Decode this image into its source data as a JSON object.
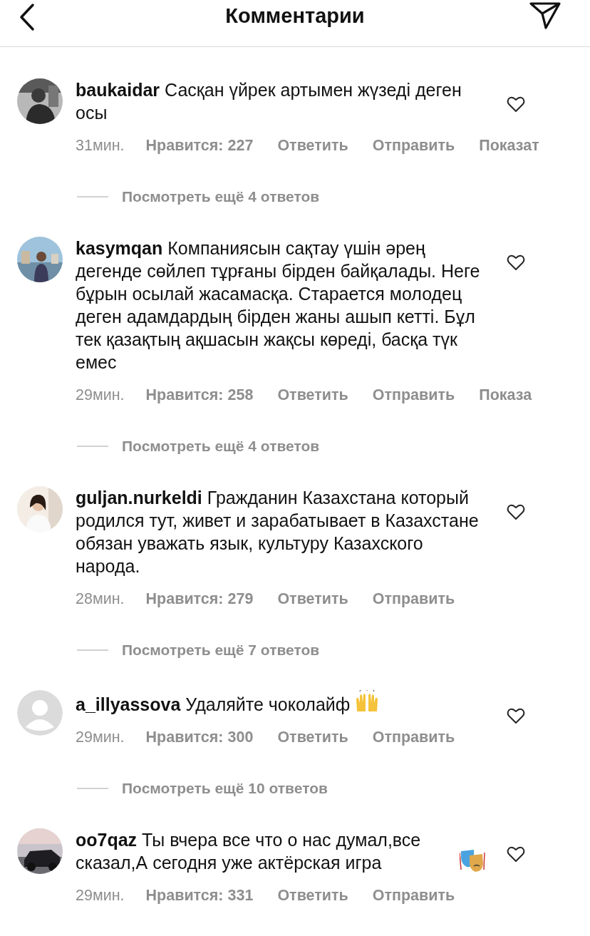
{
  "header": {
    "title": "Комментарии"
  },
  "comments": [
    {
      "text": "**baukaidar** Сасқан үйрек артымен жүзеді деген осы",
      "time": "31мин.",
      "likes": "Нравится: 227",
      "reply": "Ответить",
      "send": "Отправить",
      "more": "Показат",
      "liked": false,
      "replies": "Посмотреть ещё 4 ответов"
    },
    {
      "text": "**kasymqan** Компаниясын сақтау үшін әрең дегенде сөйлеп тұрғаны бірден байқалады. Неге бұрын осылай жасамасқа. Старается молодец деген адамдардың бірден жаны ашып кетті. Бұл тек қазақтың ақшасын жақсы көреді, басқа түк емес",
      "time": "29мин.",
      "likes": "Нравится: 258",
      "reply": "Ответить",
      "send": "Отправить",
      "more": "Показа",
      "liked": false,
      "replies": "Посмотреть ещё 4 ответов"
    },
    {
      "text": "**guljan.nurkeldi** Гражданин Казахстана который родился тут, живет и зарабатывает в Казахстане обязан уважать язык, культуру Казахского народа.",
      "time": "28мин.",
      "likes": "Нравится: 279",
      "reply": "Ответить",
      "send": "Отправить",
      "liked": false,
      "replies": "Посмотреть ещё 7 ответов"
    },
    {
      "kind": "placeholder",
      "text": "**a_illyassova** Удаляйте чоколайф",
      "trailing_icon": {
        "kind": "hands"
      },
      "time": "29мин.",
      "likes": "Нравится: 300",
      "reply": "Ответить",
      "send": "Отправить",
      "liked": false,
      "replies": "Посмотреть ещё 10 ответов"
    },
    {
      "text": "**oo7qaz** Ты вчера все что о нас думал,все сказал,А сегодня уже актёрская игра",
      "trailing_icon": {
        "kind": "masks"
      },
      "time": "29мин.",
      "likes": "Нравится: 331",
      "reply": "Ответить",
      "send": "Отправить",
      "liked": false
    }
  ]
}
